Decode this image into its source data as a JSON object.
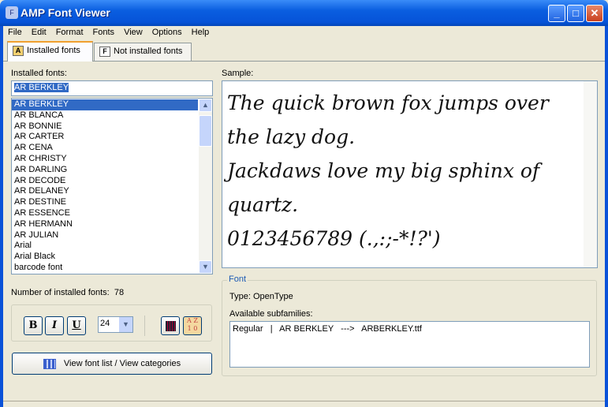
{
  "window": {
    "title": "AMP Font Viewer",
    "min": "_",
    "max": "□",
    "close": "✕"
  },
  "menu": [
    "File",
    "Edit",
    "Format",
    "Fonts",
    "View",
    "Options",
    "Help"
  ],
  "tabs": [
    {
      "label": "Installed fonts",
      "icon": "A"
    },
    {
      "label": "Not installed fonts",
      "icon": "F"
    }
  ],
  "installed": {
    "label": "Installed fonts:",
    "value": "AR BERKLEY",
    "fonts": [
      "AR BERKLEY",
      "AR BLANCA",
      "AR BONNIE",
      "AR CARTER",
      "AR CENA",
      "AR CHRISTY",
      "AR DARLING",
      "AR DECODE",
      "AR DELANEY",
      "AR DESTINE",
      "AR ESSENCE",
      "AR HERMANN",
      "AR JULIAN",
      "Arial",
      "Arial Black",
      "barcode font"
    ],
    "count_label": "Number of installed fonts:",
    "count": "78"
  },
  "sample": {
    "label": "Sample:",
    "lines": [
      "The quick brown fox jumps over",
      "the lazy dog.",
      "Jackdaws love my big sphinx of",
      "quartz.",
      "0123456789 (.,:;-*!?')"
    ]
  },
  "font_info": {
    "group_label": "Font",
    "type": "Type:  OpenType",
    "subfamilies_label": "Available subfamilies:",
    "subfamilies": "Regular   |   AR BERKLEY   --->   ARBERKLEY.ttf"
  },
  "toolbar": {
    "bold": "B",
    "italic": "I",
    "underline": "U",
    "size": "24"
  },
  "view_button": "View font list / View categories",
  "colors": {
    "titlebar": "#0a5ee0",
    "selection": "#316ac5"
  }
}
